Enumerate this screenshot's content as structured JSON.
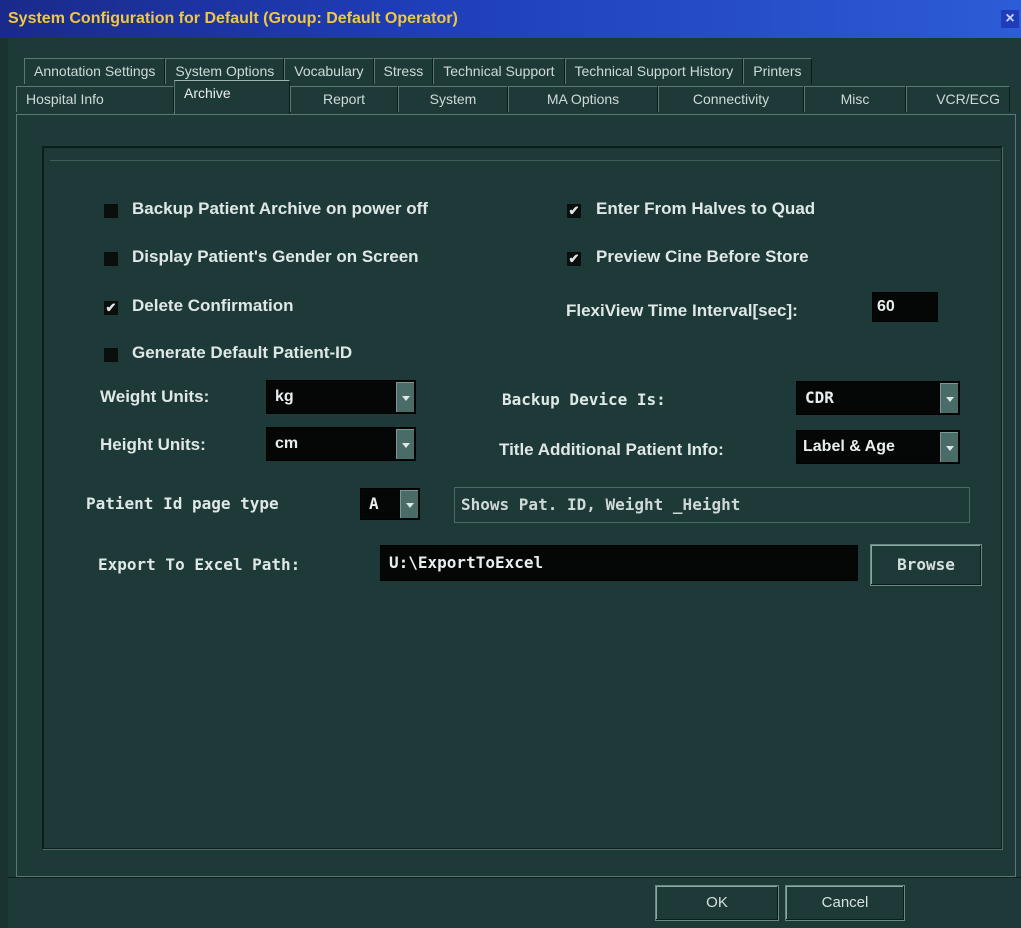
{
  "window": {
    "title": "System Configuration for Default (Group: Default Operator)",
    "close_glyph": "×"
  },
  "tabs": {
    "back_row": [
      "Annotation Settings",
      "System Options",
      "Vocabulary",
      "Stress",
      "Technical Support",
      "Technical Support History",
      "Printers"
    ],
    "front_row": [
      "Hospital Info",
      "Archive",
      "Report",
      "System",
      "MA Options",
      "Connectivity",
      "Misc",
      "VCR/ECG"
    ],
    "active": "Archive"
  },
  "checkboxes": {
    "backup_on_power_off": {
      "label": "Backup Patient Archive on power off",
      "checked": false
    },
    "display_gender": {
      "label": "Display Patient's Gender on Screen",
      "checked": false
    },
    "delete_confirmation": {
      "label": "Delete Confirmation",
      "checked": true
    },
    "generate_patient_id": {
      "label": "Generate Default Patient-ID",
      "checked": false
    },
    "halves_to_quad": {
      "label": "Enter From Halves to Quad",
      "checked": true
    },
    "preview_cine": {
      "label": "Preview Cine Before Store",
      "checked": true
    },
    "check_glyph": "✔"
  },
  "flexiview": {
    "label": "FlexiView Time Interval[sec]:",
    "value": "60"
  },
  "weight_units": {
    "label": "Weight Units:",
    "value": "kg"
  },
  "height_units": {
    "label": "Height Units:",
    "value": "cm"
  },
  "backup_device": {
    "label": "Backup Device Is:",
    "value": "CDR"
  },
  "title_info": {
    "label": "Title Additional Patient Info:",
    "value": "Label & Age"
  },
  "patient_id_page": {
    "label": "Patient Id page type",
    "value": "A",
    "description": "Shows Pat. ID, Weight _Height"
  },
  "export": {
    "label": "Export To Excel Path:",
    "value": "U:\\ExportToExcel",
    "browse_label": "Browse"
  },
  "footer": {
    "ok_label": "OK",
    "cancel_label": "Cancel"
  },
  "colors": {
    "background": "#1e3a38",
    "title_text": "#f0c840",
    "title_bar": "#1f3db8"
  }
}
